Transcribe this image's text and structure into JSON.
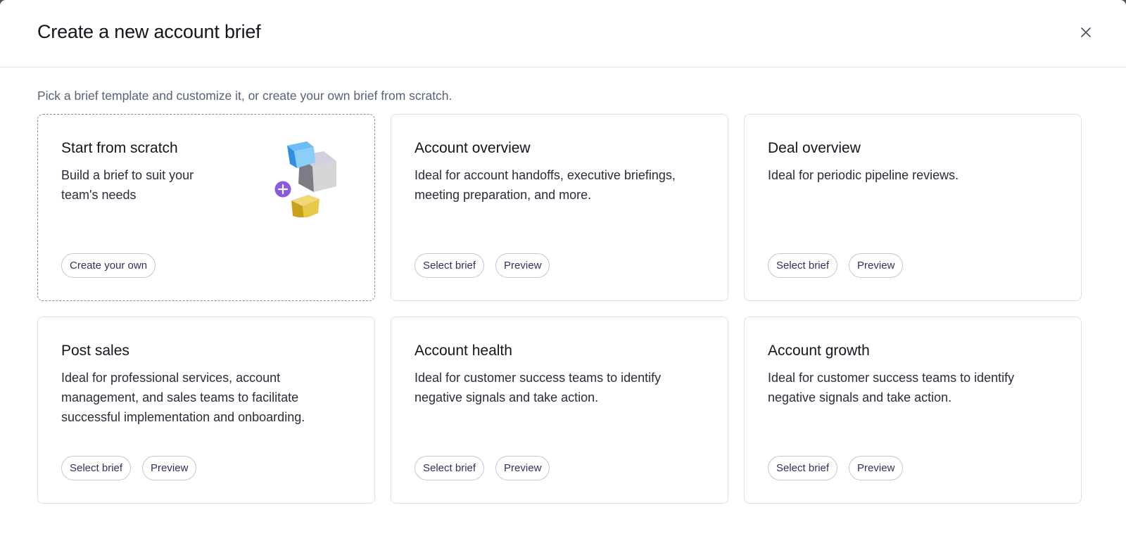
{
  "modal": {
    "title": "Create a new account brief",
    "close_icon": "close-icon",
    "subtitle": "Pick a brief template and customize it, or create your own brief from scratch."
  },
  "cards": [
    {
      "title": "Start from scratch",
      "description": "Build a brief to suit your team's needs",
      "primary_label": "Create your own",
      "illustration_icon": "cubes-plus-icon"
    },
    {
      "title": "Account overview",
      "description": "Ideal for account handoffs, executive briefings, meeting preparation, and more.",
      "primary_label": "Select brief",
      "secondary_label": "Preview"
    },
    {
      "title": "Deal overview",
      "description": "Ideal for periodic pipeline reviews.",
      "primary_label": "Select brief",
      "secondary_label": "Preview"
    },
    {
      "title": "Post sales",
      "description": "Ideal for professional services, account management, and sales teams to facilitate successful implementation and onboarding.",
      "primary_label": "Select brief",
      "secondary_label": "Preview"
    },
    {
      "title": "Account health",
      "description": "Ideal for customer success teams to identify negative signals and take action.",
      "primary_label": "Select brief",
      "secondary_label": "Preview"
    },
    {
      "title": "Account growth",
      "description": "Ideal for customer success teams to identify negative signals and take action.",
      "primary_label": "Select brief",
      "secondary_label": "Preview"
    }
  ],
  "colors": {
    "accent": "#7b5bd6",
    "pill_text": "#3a2c5c",
    "pill_border": "#c9c4dc",
    "card_border": "#dfe1e8",
    "dashed_border": "#8a88a8"
  }
}
